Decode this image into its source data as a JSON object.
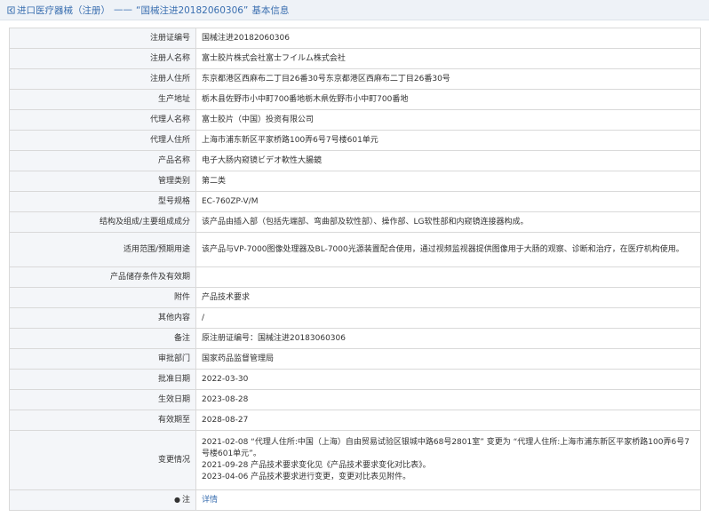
{
  "header": {
    "prefix": "进口医疗器械（注册）",
    "separator": "——",
    "subject": "“国械注进20182060306”",
    "suffix": "基本信息"
  },
  "rows": {
    "reg_no": {
      "label": "注册证编号",
      "value": "国械注进20182060306"
    },
    "registrant": {
      "label": "注册人名称",
      "value": "富士胶片株式会社富士フイルム株式会社"
    },
    "registrant_addr": {
      "label": "注册人住所",
      "value": "东京都港区西麻布二丁目26番30号东京都港区西麻布二丁目26番30号"
    },
    "mfg_addr": {
      "label": "生产地址",
      "value": "栃木县佐野市小中町700番地栃木県佐野市小中町700番地"
    },
    "agent": {
      "label": "代理人名称",
      "value": "富士胶片（中国）投资有限公司"
    },
    "agent_addr": {
      "label": "代理人住所",
      "value": "上海市浦东新区平家桥路100弄6号7号楼601单元"
    },
    "product_name": {
      "label": "产品名称",
      "value": "电子大肠内窥镜ビデオ軟性大腸鏡"
    },
    "category": {
      "label": "管理类别",
      "value": "第二类"
    },
    "model": {
      "label": "型号规格",
      "value": "EC-760ZP-V/M"
    },
    "structure": {
      "label": "结构及组成/主要组成成分",
      "value": "该产品由插入部（包括先端部、弯曲部及软性部）、操作部、LG软性部和内窥镜连接器构成。"
    },
    "scope": {
      "label": "适用范围/预期用途",
      "value": "该产品与VP-7000图像处理器及BL-7000光源装置配合使用，通过视频监视器提供图像用于大肠的观察、诊断和治疗，在医疗机构使用。"
    },
    "storage": {
      "label": "产品储存条件及有效期",
      "value": ""
    },
    "attachment": {
      "label": "附件",
      "value": "产品技术要求"
    },
    "other": {
      "label": "其他内容",
      "value": "/"
    },
    "remark": {
      "label": "备注",
      "value": "原注册证编号：国械注进20183060306"
    },
    "dept": {
      "label": "审批部门",
      "value": "国家药品监督管理局"
    },
    "approval_date": {
      "label": "批准日期",
      "value": "2022-03-30"
    },
    "effective_date": {
      "label": "生效日期",
      "value": "2023-08-28"
    },
    "expiry_date": {
      "label": "有效期至",
      "value": "2028-08-27"
    },
    "changes": {
      "label": "变更情况",
      "lines": [
        "2021-02-08 “代理人住所:中国（上海）自由贸易试验区银城中路68号2801室” 变更为 “代理人住所:上海市浦东新区平家桥路100弄6号7号楼601单元”。",
        "2021-09-28 产品技术要求变化见《产品技术要求变化对比表》。",
        "2023-04-06 产品技术要求进行变更，变更对比表见附件。"
      ]
    },
    "note": {
      "label": "注",
      "value": "详情"
    }
  }
}
